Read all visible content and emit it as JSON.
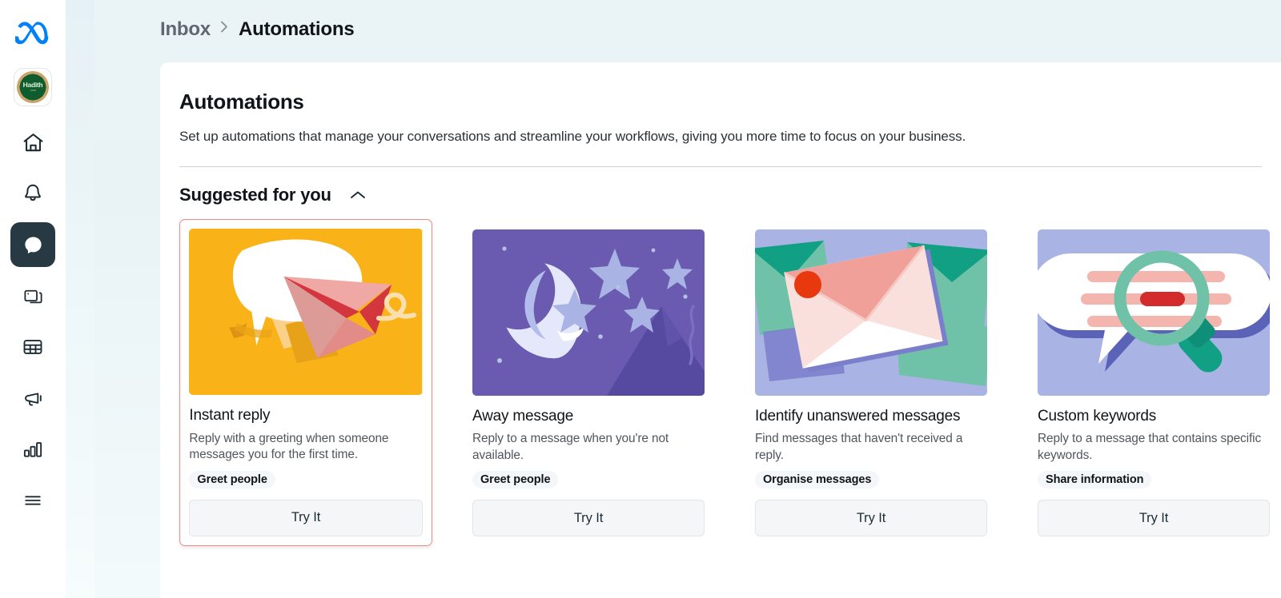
{
  "brand": {
    "logo_icon": "meta-infinity-logo",
    "accent": "#0080fb"
  },
  "breadcrumb": {
    "parent": "Inbox",
    "separator": "›",
    "current": "Automations"
  },
  "sidebar": {
    "avatar": {
      "name": "Hadith",
      "subtext": ".com",
      "icon": "business-avatar"
    },
    "items": [
      {
        "icon": "home-icon",
        "name": "home",
        "active": false
      },
      {
        "icon": "bell-icon",
        "name": "notifications",
        "active": false
      },
      {
        "icon": "chat-icon",
        "name": "inbox",
        "active": true
      },
      {
        "icon": "pages-icon",
        "name": "pages",
        "active": false
      },
      {
        "icon": "grid-icon",
        "name": "planner",
        "active": false
      },
      {
        "icon": "megaphone-icon",
        "name": "ads",
        "active": false
      },
      {
        "icon": "bar-chart-icon",
        "name": "insights",
        "active": false
      },
      {
        "icon": "menu-icon",
        "name": "more",
        "active": false
      }
    ]
  },
  "main": {
    "title": "Automations",
    "description": "Set up automations that manage your conversations and streamline your workflows, giving you more time to focus on your business.",
    "section": {
      "title": "Suggested for you",
      "toggle_icon": "chevron-up-icon",
      "expanded": true
    },
    "cards": [
      {
        "title": "Instant reply",
        "description": "Reply with a greeting when someone messages you for the first time.",
        "tag": "Greet people",
        "cta": "Try It",
        "selected": true,
        "thumb": {
          "name": "speech-bubble-paper-plane-illustration",
          "bg": "#f9b218",
          "colors": [
            "#ffffff",
            "#ef9f1b",
            "#f0a3a0",
            "#d83a3f",
            "#fbd9a0"
          ]
        }
      },
      {
        "title": "Away message",
        "description": "Reply to a message when you're not available.",
        "tag": "Greet people",
        "cta": "Try It",
        "selected": false,
        "thumb": {
          "name": "night-moon-stars-illustration",
          "bg": "#6a5bb0",
          "colors": [
            "#dfe3f7",
            "#aab4e4",
            "#5549a0",
            "#4e4296"
          ]
        }
      },
      {
        "title": "Identify unanswered messages",
        "description": "Find messages that haven't received a reply.",
        "tag": "Organise messages",
        "cta": "Try It",
        "selected": false,
        "thumb": {
          "name": "envelopes-unread-dot-illustration",
          "bg": "#aab4e4",
          "colors": [
            "#ffffff",
            "#f0a099",
            "#6fc2a8",
            "#12a085",
            "#e8380d",
            "#7b7ecb"
          ]
        }
      },
      {
        "title": "Custom keywords",
        "description": "Reply to a message that contains specific keywords.",
        "tag": "Share information",
        "cta": "Try It",
        "selected": false,
        "thumb": {
          "name": "speech-bubble-magnifier-illustration",
          "bg": "#aab4e4",
          "colors": [
            "#ffffff",
            "#f3b5ae",
            "#d32b2b",
            "#6fc2a8",
            "#12a085",
            "#5b63b8"
          ]
        }
      }
    ]
  }
}
